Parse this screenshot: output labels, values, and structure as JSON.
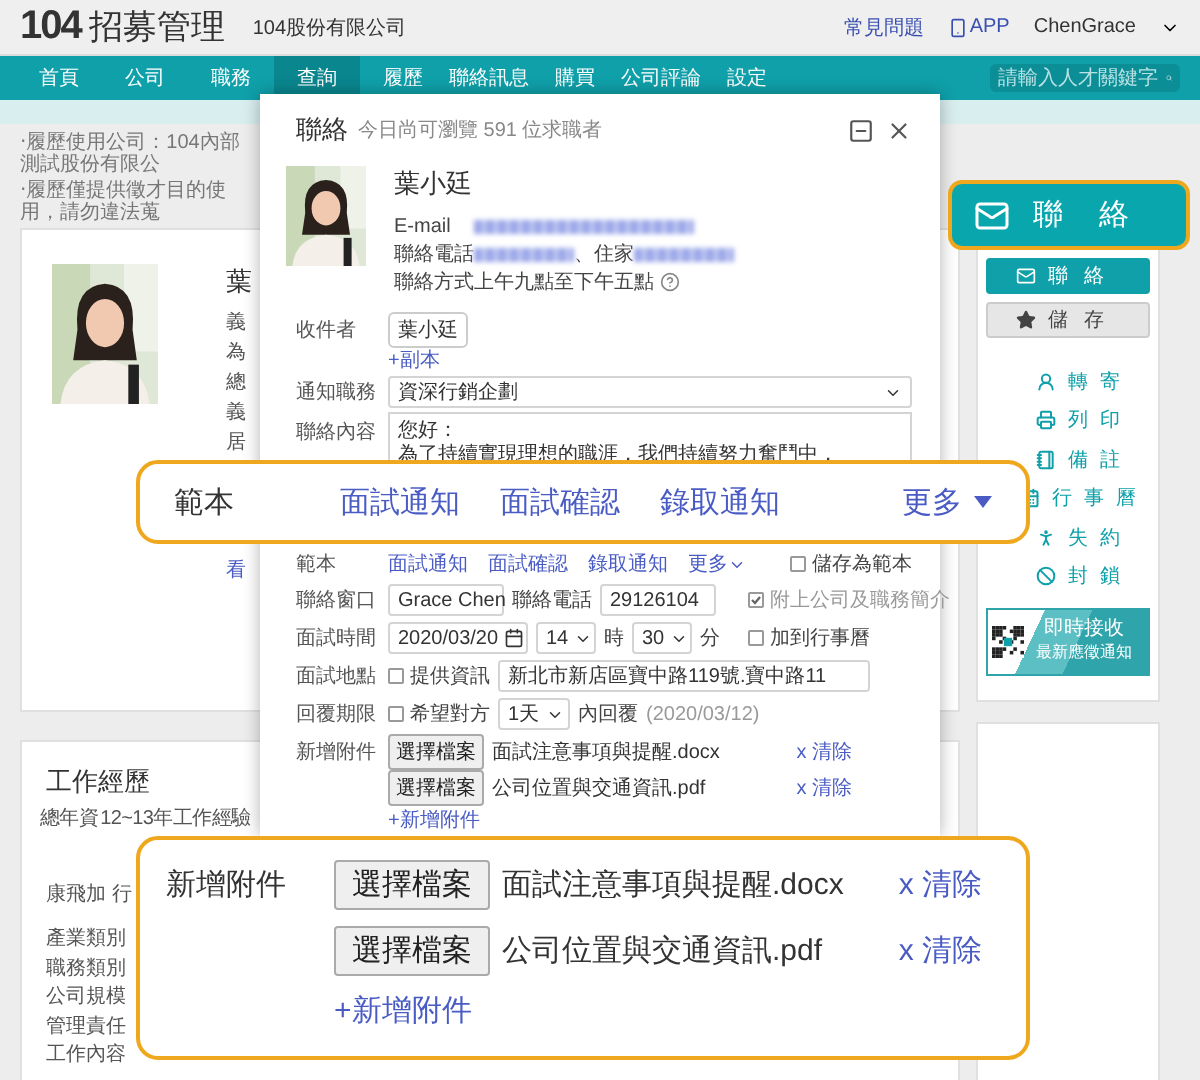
{
  "header": {
    "logo": "104",
    "title": "招募管理",
    "company": "104股份有限公司",
    "links": [
      {
        "kind": "help",
        "label": "常見問題"
      },
      {
        "kind": "app",
        "label": "APP"
      }
    ],
    "user": "ChenGrace"
  },
  "nav": {
    "items": [
      {
        "label": "首頁",
        "selected": false
      },
      {
        "label": "公司",
        "selected": false
      },
      {
        "label": "職務",
        "selected": false
      },
      {
        "label": "查詢",
        "selected": true
      },
      {
        "label": "履歷",
        "selected": false
      },
      {
        "label": "聯絡訊息",
        "selected": false
      },
      {
        "label": "購買",
        "selected": false
      },
      {
        "label": "公司評論",
        "selected": false
      },
      {
        "label": "設定",
        "selected": false
      }
    ],
    "search": {
      "placeholder": "請輸入人才關鍵字"
    }
  },
  "resume": {
    "notices": [
      "‧履歷使用公司：104內部測試股份有限公",
      "‧履歷僅提供徵才目的使用，請勿違法蒐"
    ],
    "name_fragment": "葉",
    "field_fragments": [
      "義",
      "為",
      "總",
      "義",
      "居"
    ],
    "link_fragment": "看"
  },
  "experience": {
    "title": "工作經歷",
    "total_label": "總年資",
    "total_value": "12~13年工作經驗",
    "job": "康飛加 行",
    "fields": [
      "產業類別",
      "職務類別",
      "公司規模",
      "管理責任",
      "工作內容"
    ]
  },
  "sidebar": {
    "buttons": [
      {
        "kind": "contact",
        "label": "聯絡"
      },
      {
        "kind": "save",
        "label": "儲存"
      }
    ],
    "items": [
      {
        "kind": "forward",
        "label": "轉寄"
      },
      {
        "kind": "print",
        "label": "列印"
      },
      {
        "kind": "note",
        "label": "備註"
      },
      {
        "kind": "calendar",
        "label": "行事曆"
      },
      {
        "kind": "noshow",
        "label": "失約"
      },
      {
        "kind": "block",
        "label": "封鎖"
      }
    ],
    "promo": {
      "lines": [
        "即時接收",
        "最新應徵通知"
      ]
    }
  },
  "modal": {
    "title": "聯絡",
    "subtitle": "今日尚可瀏覽 591 位求職者",
    "candidate": {
      "name": "葉小廷",
      "rows": [
        {
          "label": "E-mail",
          "parts": [
            {
              "kind": "blur"
            }
          ]
        },
        {
          "label": "聯絡電話",
          "parts": [
            {
              "kind": "blur"
            },
            {
              "kind": "text",
              "text": "、住家"
            },
            {
              "kind": "blur"
            }
          ]
        },
        {
          "label": "聯絡方式",
          "parts": [
            {
              "kind": "text",
              "text": "上午九點至下午五點"
            },
            {
              "kind": "help"
            }
          ]
        }
      ]
    },
    "recipient": {
      "label": "收件者",
      "chips": [
        "葉小廷"
      ],
      "cc": "+副本"
    },
    "job": {
      "label": "通知職務",
      "value": "資深行銷企劃"
    },
    "content": {
      "label": "聯絡內容",
      "lines": [
        "您好：",
        "為了持續實現理想的職涯，我們持續努力奮鬥中，"
      ]
    },
    "templates": {
      "label": "範本",
      "links": [
        "面試通知",
        "面試確認",
        "錄取通知"
      ],
      "more": "更多",
      "save": {
        "label": "儲存為範本",
        "checked": false
      }
    },
    "contact": {
      "label": "聯絡窗口",
      "name": "Grace Chen",
      "phone_label": "聯絡電話",
      "phone": "29126104",
      "attach_intro": {
        "label": "附上公司及職務簡介",
        "checked": true,
        "disabled": true
      }
    },
    "interview_time": {
      "label": "面試時間",
      "date": "2020/03/20",
      "hour": "14",
      "hour_unit": "時",
      "minute": "30",
      "minute_unit": "分",
      "calendar": {
        "label": "加到行事曆",
        "checked": false
      }
    },
    "interview_place": {
      "label": "面試地點",
      "provide": {
        "label": "提供資訊",
        "checked": false
      },
      "address": "新北市新店區寶中路119號.寶中路11"
    },
    "reply": {
      "label": "回覆期限",
      "hope": {
        "label": "希望對方",
        "checked": false
      },
      "days": "1天",
      "suffix": "內回覆",
      "date": "(2020/03/12)"
    },
    "attachments": {
      "label": "新增附件",
      "files": [
        {
          "button": "選擇檔案",
          "name": "面試注意事項與提醒.docx",
          "clear": "x 清除"
        },
        {
          "button": "選擇檔案",
          "name": "公司位置與交通資訊.pdf",
          "clear": "x 清除"
        }
      ],
      "add": "+新增附件"
    }
  },
  "callout_contact": {
    "label": "聯絡"
  },
  "callout_templates": {
    "label": "範本",
    "links": [
      "面試通知",
      "面試確認",
      "錄取通知"
    ],
    "more": "更多"
  },
  "callout_attachments": {
    "label": "新增附件",
    "files": [
      {
        "button": "選擇檔案",
        "name": "面試注意事項與提醒.docx",
        "clear": "x 清除"
      },
      {
        "button": "選擇檔案",
        "name": "公司位置與交通資訊.pdf",
        "clear": "x 清除"
      }
    ],
    "add": "+新增附件"
  }
}
